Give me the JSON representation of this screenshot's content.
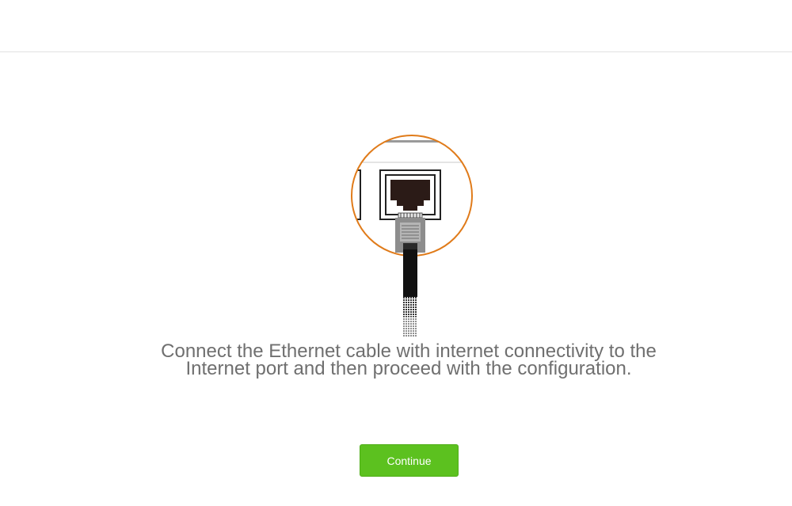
{
  "header": {},
  "illustration": {
    "icon": "ethernet-port-cable-icon",
    "accent_color": "#e07b1a"
  },
  "main": {
    "instruction": "Connect the Ethernet cable with internet connectivity to the Internet port and then proceed with the configuration."
  },
  "actions": {
    "continue_label": "Continue",
    "continue_color": "#5cc11f"
  }
}
